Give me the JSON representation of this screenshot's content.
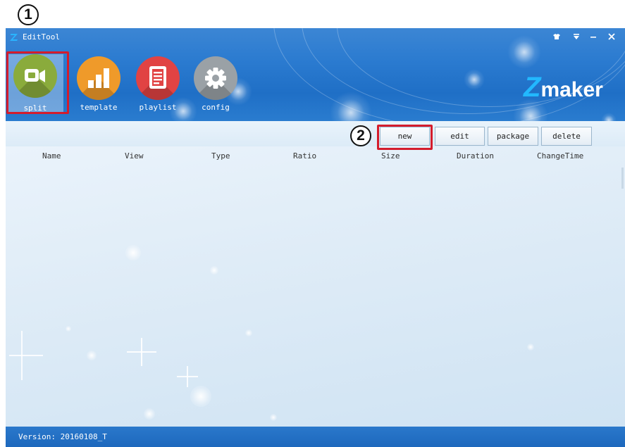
{
  "window": {
    "title": "EditTool"
  },
  "annotations": {
    "marker_1": "1",
    "marker_2": "2"
  },
  "toolbar_tools": [
    {
      "label": "split",
      "icon": "video-camera-icon",
      "color": "#8aab3c",
      "selected": true
    },
    {
      "label": "template",
      "icon": "bar-chart-icon",
      "color": "#ef9a2a",
      "selected": false
    },
    {
      "label": "playlist",
      "icon": "document-list-icon",
      "color": "#e14343",
      "selected": false
    },
    {
      "label": "config",
      "icon": "gear-icon",
      "color": "#9aa1a6",
      "selected": false
    }
  ],
  "brand": {
    "logo_z": "Z",
    "logo_text": "maker"
  },
  "actions": {
    "new": "new",
    "edit": "edit",
    "package": "package",
    "delete": "delete"
  },
  "table": {
    "columns": [
      "Name",
      "View",
      "Type",
      "Ratio",
      "Size",
      "Duration",
      "ChangeTime"
    ],
    "rows": []
  },
  "status": {
    "version": "Version: 20160108_T"
  },
  "colors": {
    "title_bar": "#2b7bd0",
    "accent_red": "#d41c2c"
  }
}
